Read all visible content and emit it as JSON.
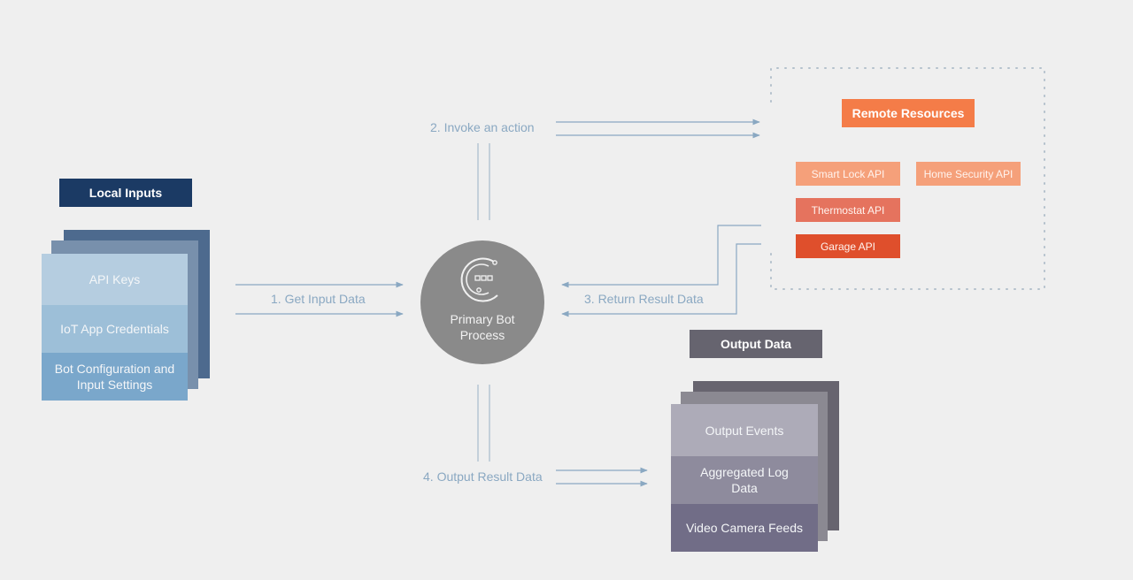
{
  "local_inputs": {
    "title": "Local Inputs",
    "items": [
      "API Keys",
      "IoT App Credentials",
      "Bot Configuration and Input Settings"
    ]
  },
  "bot": {
    "label": "Primary Bot Process",
    "icon": "bot-circuit-icon"
  },
  "remote_resources": {
    "title": "Remote Resources",
    "apis": [
      {
        "label": "Smart Lock API",
        "color": "#f5a07a"
      },
      {
        "label": "Home Security API",
        "color": "#f5a07a"
      },
      {
        "label": "Thermostat API",
        "color": "#e5735e"
      },
      {
        "label": "Garage API",
        "color": "#df4f2c"
      }
    ],
    "title_color": "#f47c48"
  },
  "output_data": {
    "title": "Output Data",
    "items": [
      "Output Events",
      "Aggregated Log Data",
      "Video Camera Feeds"
    ]
  },
  "flows": {
    "step1": "1. Get Input Data",
    "step2": "2. Invoke an action",
    "step3": "3. Return Result Data",
    "step4": "4. Output Result Data"
  },
  "colors": {
    "background": "#efefef",
    "local_title": "#1b3a64",
    "output_title": "#66646f",
    "bot_circle": "#8a8a8a",
    "arrow": "#8aa8c2"
  }
}
